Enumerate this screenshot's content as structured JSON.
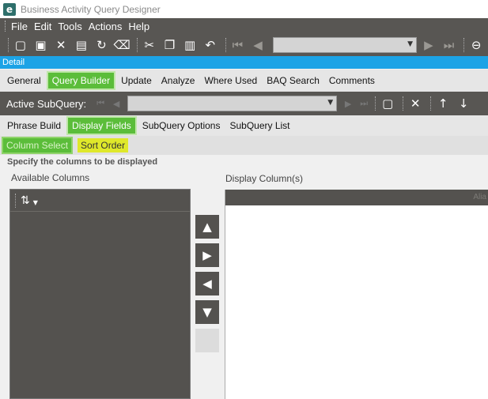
{
  "window": {
    "title": "Business Activity Query Designer",
    "logo_letter": "e"
  },
  "menu": [
    "File",
    "Edit",
    "Tools",
    "Actions",
    "Help"
  ],
  "detail_bar": "Detail",
  "main_tabs": [
    {
      "label": "General",
      "active": false
    },
    {
      "label": "Query Builder",
      "active": true
    },
    {
      "label": "Update",
      "active": false
    },
    {
      "label": "Analyze",
      "active": false
    },
    {
      "label": "Where Used",
      "active": false
    },
    {
      "label": "BAQ Search",
      "active": false
    },
    {
      "label": "Comments",
      "active": false
    }
  ],
  "subquery": {
    "label": "Active SubQuery:",
    "value": ""
  },
  "sub_tabs": [
    {
      "label": "Phrase Build",
      "active": false
    },
    {
      "label": "Display Fields",
      "active": true
    },
    {
      "label": "SubQuery Options",
      "active": false
    },
    {
      "label": "SubQuery List",
      "active": false
    }
  ],
  "field_tabs": [
    {
      "label": "Column Select",
      "state": "active"
    },
    {
      "label": "Sort Order",
      "state": "highlight"
    }
  ],
  "hint": "Specify the columns to be displayed",
  "available": {
    "label": "Available Columns"
  },
  "display": {
    "label": "Display Column(s)",
    "header_text": "Alia"
  },
  "colors": {
    "accent_green": "#5bbd3a",
    "detail_blue": "#1ca3e6",
    "toolbar_dark": "#585653",
    "highlight_yellow": "#dfe82a"
  }
}
